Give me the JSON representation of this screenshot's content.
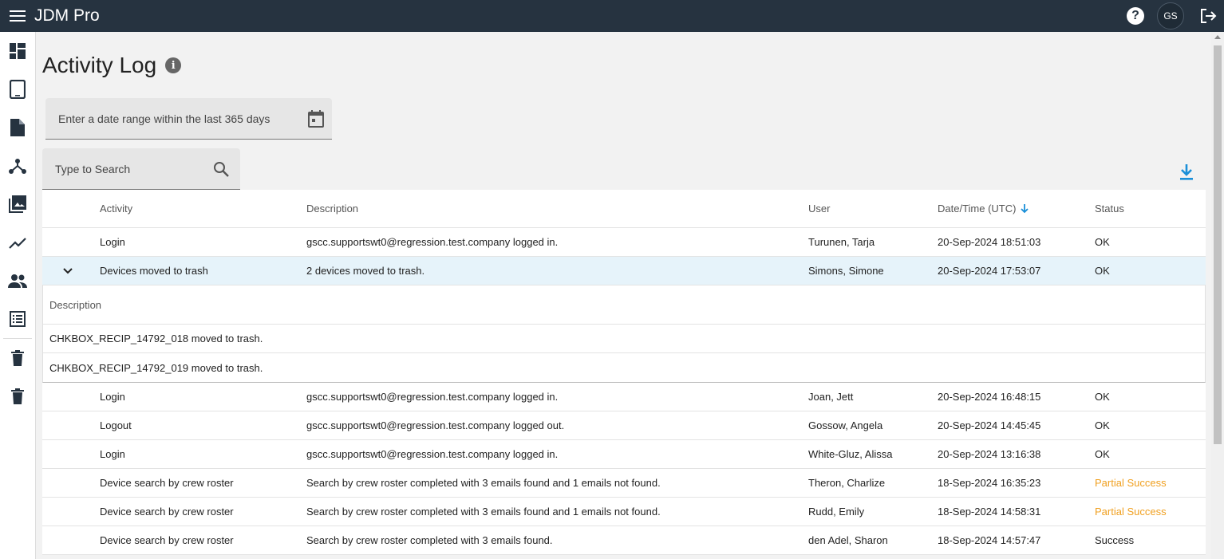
{
  "app": {
    "title": "JDM Pro",
    "user_initials": "GS"
  },
  "icons": {
    "menu": "menu-icon",
    "help": "help-icon",
    "logout": "logout-icon",
    "sidebar": [
      "dashboard-icon",
      "tablet-icon",
      "document-icon",
      "hierarchy-icon",
      "photo-library-icon",
      "trending-icon",
      "people-icon",
      "list-icon",
      "trash-icon",
      "trash-icon"
    ]
  },
  "page": {
    "title": "Activity Log",
    "date_placeholder": "Enter a date range within the last 365 days",
    "search_placeholder": "Type to Search"
  },
  "table": {
    "headers": {
      "activity": "Activity",
      "description": "Description",
      "user": "User",
      "datetime": "Date/Time (UTC)",
      "status": "Status"
    },
    "detail_header": "Description",
    "rows": [
      {
        "activity": "Login",
        "description": "gscc.supportswt0@regression.test.company logged in.",
        "user": "Turunen, Tarja",
        "datetime": "20-Sep-2024 18:51:03",
        "status": "OK"
      },
      {
        "activity": "Devices moved to trash",
        "description": "2 devices moved to trash.",
        "user": "Simons, Simone",
        "datetime": "20-Sep-2024 17:53:07",
        "status": "OK"
      },
      {
        "activity": "Login",
        "description": "gscc.supportswt0@regression.test.company logged in.",
        "user": "Joan, Jett",
        "datetime": "20-Sep-2024 16:48:15",
        "status": "OK"
      },
      {
        "activity": "Logout",
        "description": "gscc.supportswt0@regression.test.company logged out.",
        "user": "Gossow, Angela",
        "datetime": "20-Sep-2024 14:45:45",
        "status": "OK"
      },
      {
        "activity": "Login",
        "description": "gscc.supportswt0@regression.test.company logged in.",
        "user": "White-Gluz, Alissa",
        "datetime": "20-Sep-2024 13:16:38",
        "status": "OK"
      },
      {
        "activity": "Device search by crew roster",
        "description": "Search by crew roster completed with 3 emails found and 1 emails not found.",
        "user": "Theron, Charlize",
        "datetime": "18-Sep-2024 16:35:23",
        "status": "Partial Success"
      },
      {
        "activity": "Device search by crew roster",
        "description": "Search by crew roster completed with 3 emails found and 1 emails not found.",
        "user": "Rudd, Emily",
        "datetime": "18-Sep-2024 14:58:31",
        "status": "Partial Success"
      },
      {
        "activity": "Device search by crew roster",
        "description": "Search by crew roster completed with 3 emails found.",
        "user": "den Adel, Sharon",
        "datetime": "18-Sep-2024 14:57:47",
        "status": "Success"
      }
    ],
    "details": [
      "CHKBOX_RECIP_14792_018 moved to trash.",
      "CHKBOX_RECIP_14792_019 moved to trash."
    ]
  },
  "colors": {
    "topbar": "#263340",
    "accent": "#1a8fd8",
    "partial": "#f0a020",
    "expanded_row": "#e6f3fa"
  }
}
